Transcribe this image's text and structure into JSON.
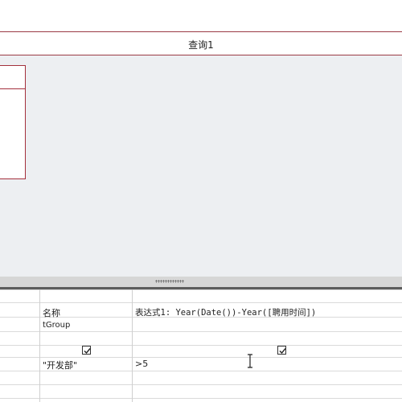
{
  "document_tab": {
    "title": "查询1"
  },
  "grid": {
    "rows": [
      {
        "field": "名称",
        "expression": "表达式1: Year(Date())-Year([聘用时间])"
      },
      {
        "table": "tGroup",
        "expression_table": ""
      },
      {
        "show_field": true,
        "show_expression": true
      },
      {
        "criteria_field": "\"开发部\"",
        "criteria_expression": ">5"
      }
    ]
  },
  "icons": {
    "cursor": "text-ibeam-cursor",
    "splitter": "splitter-grip-icon"
  }
}
